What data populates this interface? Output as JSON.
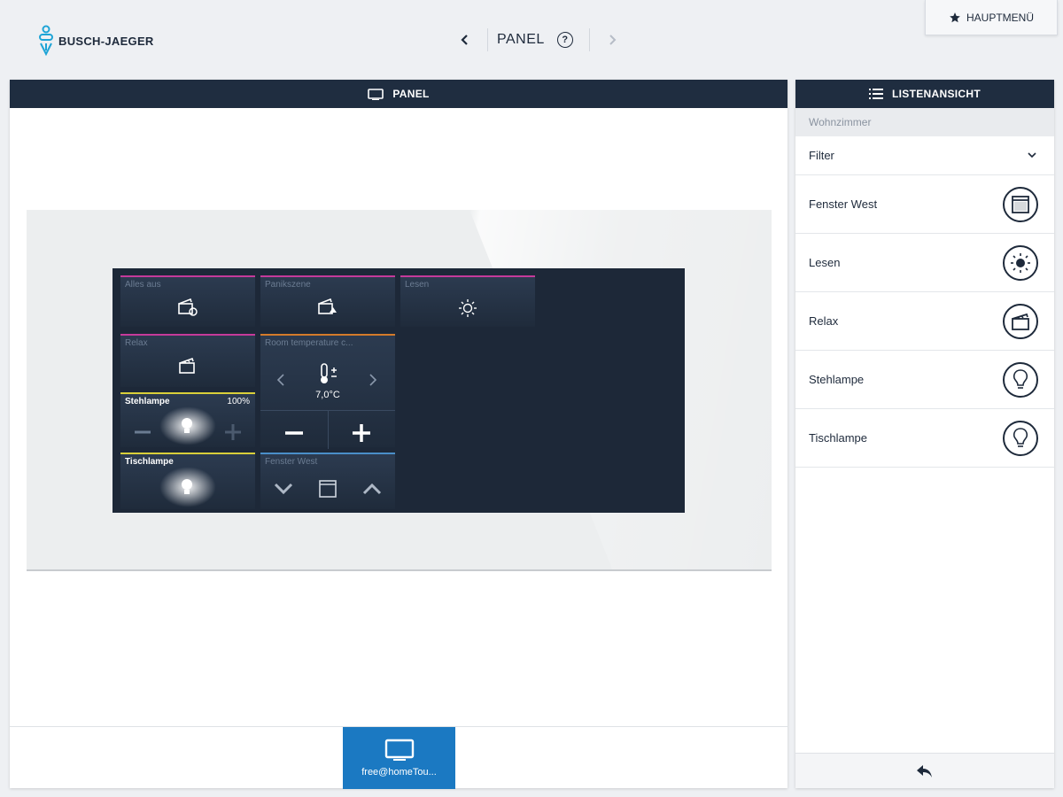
{
  "brand": {
    "name": "BUSCH-JAEGER"
  },
  "nav": {
    "title": "PANEL",
    "back_icon": "chevron-left-icon",
    "forward_icon": "chevron-right-icon",
    "help_glyph": "?"
  },
  "main_menu": {
    "label": "HAUPTMENÜ",
    "icon": "star-icon"
  },
  "panel": {
    "header_label": "PANEL",
    "tiles": {
      "alles_aus": {
        "label": "Alles aus",
        "icon": "scene-icon"
      },
      "panikszene": {
        "label": "Panikszene",
        "icon": "scene-icon"
      },
      "lesen": {
        "label": "Lesen",
        "icon": "sun-icon"
      },
      "relax": {
        "label": "Relax",
        "icon": "clapper-icon"
      },
      "room_temp": {
        "label": "Room temperature c...",
        "value": "7,0°C",
        "icon": "thermometer-icon"
      },
      "stehlampe": {
        "label": "Stehlampe",
        "percent": "100%",
        "icon": "bulb-icon"
      },
      "tischlampe": {
        "label": "Tischlampe",
        "icon": "bulb-icon"
      },
      "fenster_west": {
        "label": "Fenster West",
        "icon": "window-icon"
      }
    },
    "colors": {
      "magenta": "#c53a9a",
      "orange": "#d47a2a",
      "yellow": "#d9cf3a",
      "blue": "#4a8fc9",
      "active": "#1b79c2",
      "header": "#1f2d40"
    },
    "footer_device": {
      "label": "free@homeTou...",
      "icon": "monitor-icon"
    }
  },
  "listview": {
    "header_label": "LISTENANSICHT",
    "room": "Wohnzimmer",
    "filter_label": "Filter",
    "items": [
      {
        "label": "Fenster West",
        "icon": "window-icon"
      },
      {
        "label": "Lesen",
        "icon": "sun-icon"
      },
      {
        "label": "Relax",
        "icon": "clapper-icon"
      },
      {
        "label": "Stehlampe",
        "icon": "bulb-icon"
      },
      {
        "label": "Tischlampe",
        "icon": "bulb-icon"
      }
    ],
    "footer_icon": "back-arrow-icon"
  }
}
